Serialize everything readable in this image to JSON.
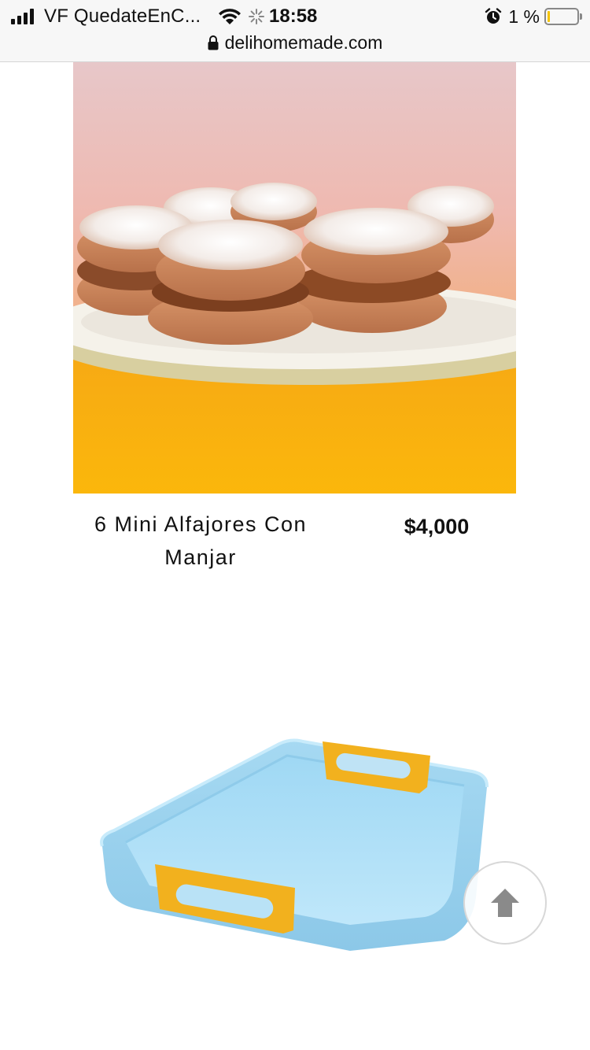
{
  "status_bar": {
    "carrier": "VF QuedateEnC...",
    "time": "18:58",
    "battery_percent": "1 %",
    "battery_level": 0.01
  },
  "browser": {
    "url": "delihomemade.com"
  },
  "products": [
    {
      "name": "6 Mini Alfajores Con Manjar",
      "price": "$4,000",
      "image": "alfajores-photo"
    },
    {
      "image": "blue-tray-photo"
    }
  ],
  "icons": [
    "signal-bars-icon",
    "wifi-icon",
    "loading-spinner-icon",
    "alarm-icon",
    "battery-icon",
    "lock-icon",
    "arrow-up-icon"
  ],
  "colors": {
    "tray_blue": "#a9dcf5",
    "tray_handle": "#f2b11e",
    "background_orange": "#f8b515"
  }
}
